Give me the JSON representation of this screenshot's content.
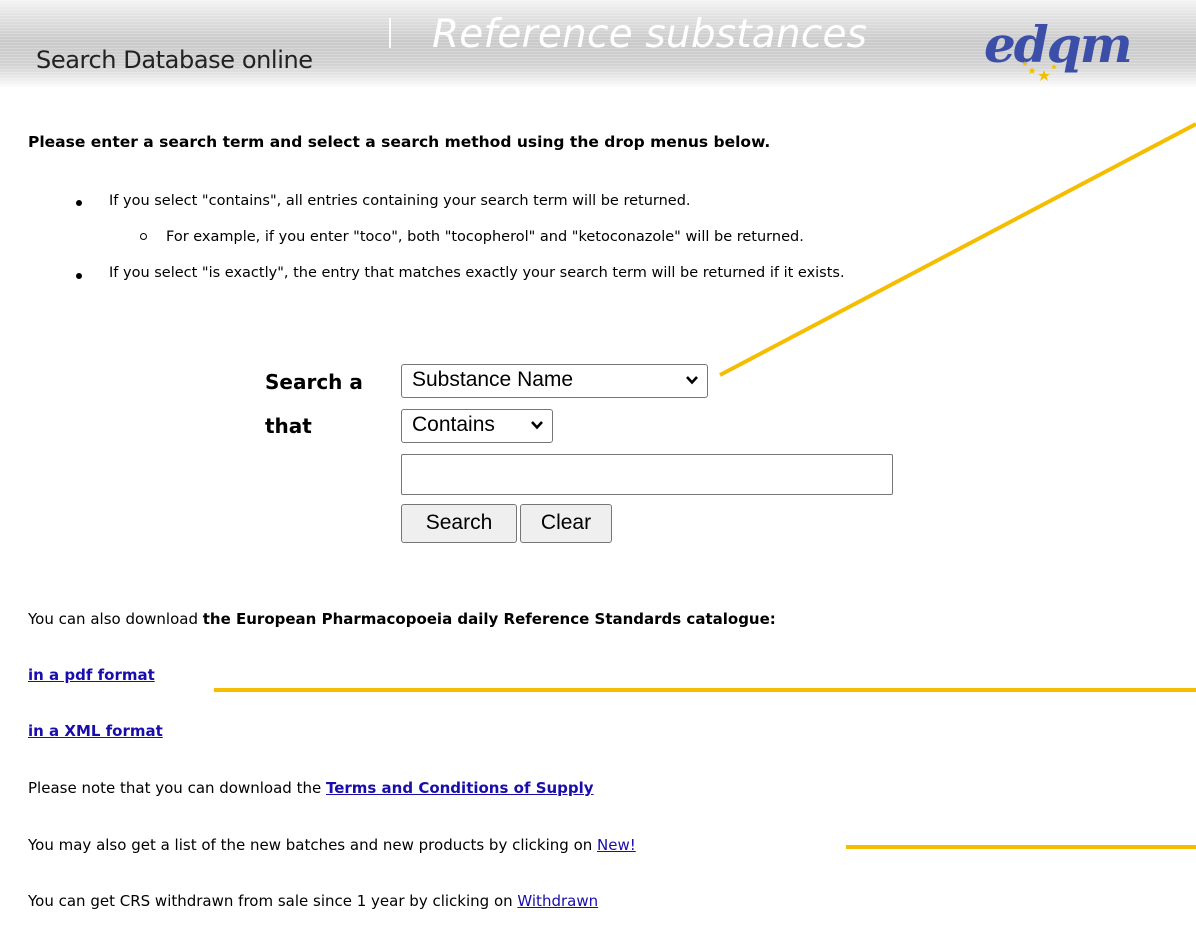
{
  "banner": {
    "title": "Search Database online",
    "separator": "|",
    "subtitle": "Reference substances",
    "logo_text": "edqm"
  },
  "intro": "Please enter a search term and select a search method using the drop menus below.",
  "bullets": {
    "contains": "If you select \"contains\", all entries containing your search term will be returned.",
    "example": "For example, if you enter \"toco\", both \"tocopherol\" and \"ketoconazole\" will be returned.",
    "exactly": "If you select \"is exactly\", the entry that matches exactly your search term will be returned if it exists."
  },
  "form": {
    "search_a_label": "Search a",
    "that_label": "that",
    "field_select_value": "Substance Name",
    "method_select_value": "Contains",
    "search_input_value": "",
    "search_button": "Search",
    "clear_button": "Clear"
  },
  "download": {
    "prefix": "You can also download ",
    "bold": "the European Pharmacopoeia daily Reference Standards catalogue:",
    "pdf_link": "in a pdf format",
    "xml_link": "in a XML format"
  },
  "terms": {
    "prefix": "Please note that you can download the ",
    "link": "Terms and Conditions of Supply"
  },
  "new_items": {
    "prefix": "You may also get a list of the new batches and new products by clicking on ",
    "link": "New!"
  },
  "withdrawn": {
    "prefix": "You can get CRS withdrawn from sale since 1 year by clicking on ",
    "link": "Withdrawn"
  },
  "colors": {
    "annotation": "#f5bd00",
    "link": "#1a0dab",
    "logo": "#3c4fa8",
    "star": "#f0c000"
  }
}
